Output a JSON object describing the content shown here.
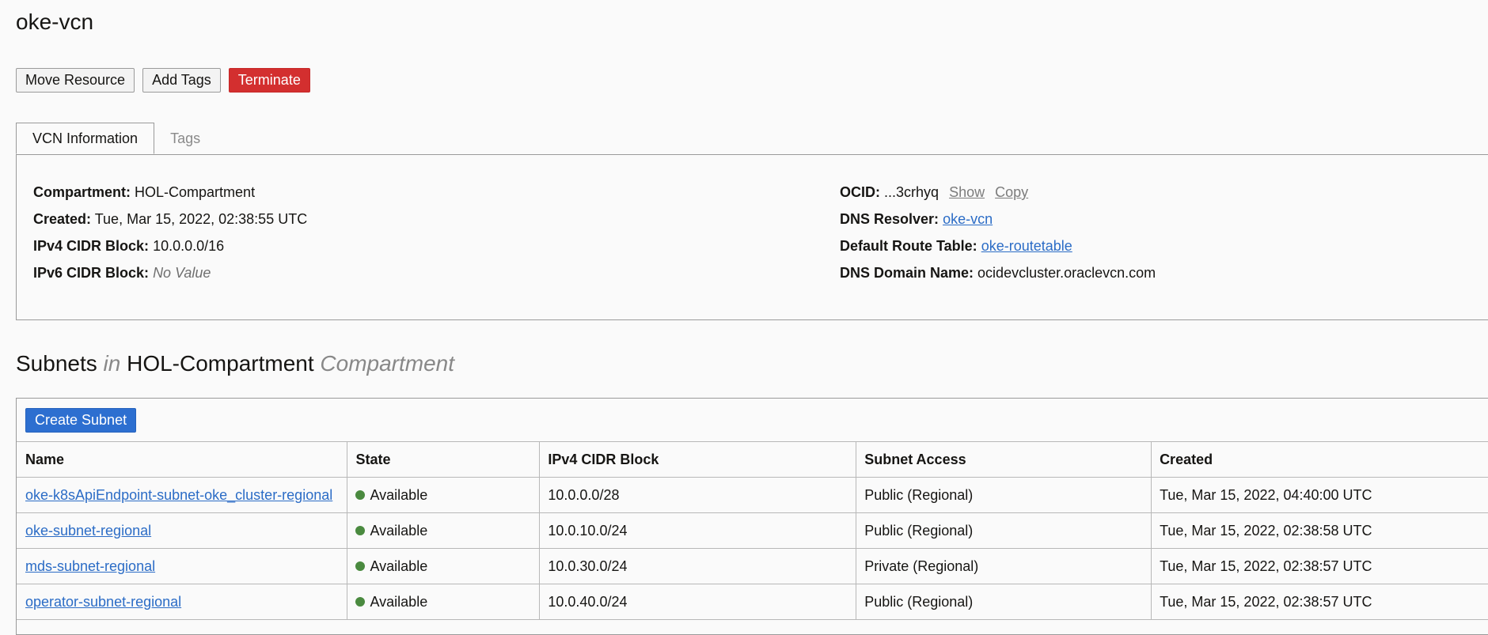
{
  "page": {
    "title": "oke-vcn"
  },
  "actions": {
    "move_resource": "Move Resource",
    "add_tags": "Add Tags",
    "terminate": "Terminate"
  },
  "tabs": [
    {
      "label": "VCN Information",
      "active": true
    },
    {
      "label": "Tags",
      "active": false
    }
  ],
  "info": {
    "compartment_label": "Compartment:",
    "compartment_value": "HOL-Compartment",
    "created_label": "Created:",
    "created_value": "Tue, Mar 15, 2022, 02:38:55 UTC",
    "ipv4_label": "IPv4 CIDR Block:",
    "ipv4_value": "10.0.0.0/16",
    "ipv6_label": "IPv6 CIDR Block:",
    "ipv6_value": "No Value",
    "ocid_label": "OCID:",
    "ocid_value": "...3crhyq",
    "ocid_show": "Show",
    "ocid_copy": "Copy",
    "dns_resolver_label": "DNS Resolver:",
    "dns_resolver_value": "oke-vcn",
    "route_table_label": "Default Route Table:",
    "route_table_value": "oke-routetable",
    "dns_domain_label": "DNS Domain Name:",
    "dns_domain_value": "ocidevcluster.oraclevcn.com"
  },
  "subnets": {
    "title_prefix": "Subnets",
    "title_in": "in",
    "compartment": "HOL-Compartment",
    "title_suffix": "Compartment",
    "create_button": "Create Subnet",
    "columns": [
      "Name",
      "State",
      "IPv4 CIDR Block",
      "Subnet Access",
      "Created"
    ],
    "rows": [
      {
        "name": "oke-k8sApiEndpoint-subnet-oke_cluster-regional",
        "state": "Available",
        "cidr": "10.0.0.0/28",
        "access": "Public (Regional)",
        "created": "Tue, Mar 15, 2022, 04:40:00 UTC"
      },
      {
        "name": "oke-subnet-regional",
        "state": "Available",
        "cidr": "10.0.10.0/24",
        "access": "Public (Regional)",
        "created": "Tue, Mar 15, 2022, 02:38:58 UTC"
      },
      {
        "name": "mds-subnet-regional",
        "state": "Available",
        "cidr": "10.0.30.0/24",
        "access": "Private (Regional)",
        "created": "Tue, Mar 15, 2022, 02:38:57 UTC"
      },
      {
        "name": "operator-subnet-regional",
        "state": "Available",
        "cidr": "10.0.40.0/24",
        "access": "Public (Regional)",
        "created": "Tue, Mar 15, 2022, 02:38:57 UTC"
      }
    ]
  },
  "colors": {
    "available": "#4a8a3f",
    "link": "#2b6cc6",
    "terminate": "#d32f2f",
    "primary": "#2d6fd0"
  }
}
